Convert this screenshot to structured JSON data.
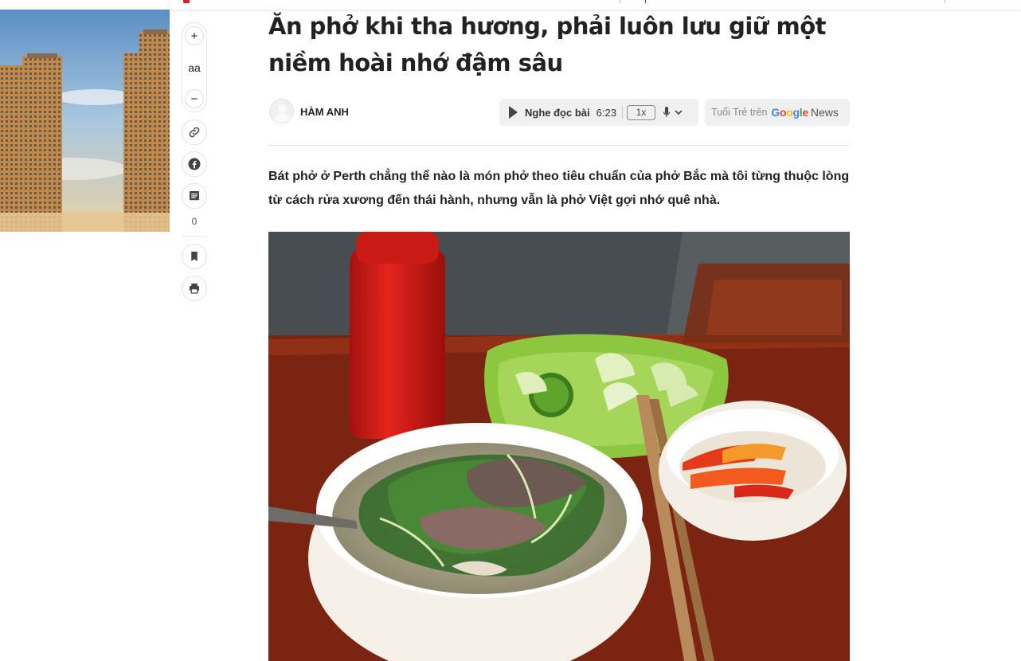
{
  "article": {
    "headline": "Ăn phở khi tha hương, phải luôn lưu giữ một niềm hoài nhớ đậm sâu",
    "author": "HÀM ANH",
    "sapo": "Bát phở ở Perth chẳng thể nào là món phở theo tiêu chuẩn của phở Bắc mà tôi từng thuộc lòng từ cách rửa xương đến thái hành, nhưng vẫn là phở Việt gợi nhớ quê nhà."
  },
  "audio": {
    "label": "Nghe đọc bài",
    "duration": "6:23",
    "speed": "1x",
    "icons": [
      "play-icon",
      "mic-icon",
      "chevron-down-icon"
    ]
  },
  "google_news": {
    "prefix": "Tuổi Trẻ trên",
    "brand": "Google",
    "suffix": "News",
    "brand_colors": [
      "#4285F4",
      "#EA4335",
      "#FBBC05",
      "#4285F4",
      "#34A853",
      "#EA4335"
    ]
  },
  "toolbar": {
    "font_increase": "+",
    "font_size": "aa",
    "font_decrease": "−",
    "comment_count": "0",
    "icons": [
      "link-icon",
      "facebook-icon",
      "comment-icon",
      "bookmark-icon",
      "print-icon"
    ]
  },
  "colors": {
    "brand_red": "#d61f26",
    "facebook": "#444444",
    "text": "#222222"
  }
}
